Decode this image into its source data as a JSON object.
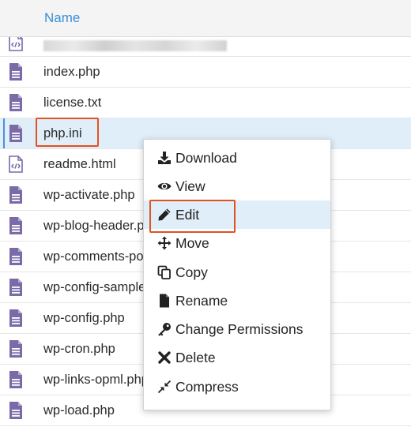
{
  "table": {
    "header": {
      "name_label": "Name"
    },
    "files": [
      {
        "name": "",
        "icon": "html-file-icon",
        "redacted": true
      },
      {
        "name": "index.php",
        "icon": "document-icon"
      },
      {
        "name": "license.txt",
        "icon": "document-icon"
      },
      {
        "name": "php.ini",
        "icon": "document-icon",
        "selected": true
      },
      {
        "name": "readme.html",
        "icon": "html-file-icon"
      },
      {
        "name": "wp-activate.php",
        "icon": "document-icon"
      },
      {
        "name": "wp-blog-header.php",
        "icon": "document-icon"
      },
      {
        "name": "wp-comments-post.php",
        "icon": "document-icon"
      },
      {
        "name": "wp-config-sample.php",
        "icon": "document-icon"
      },
      {
        "name": "wp-config.php",
        "icon": "document-icon"
      },
      {
        "name": "wp-cron.php",
        "icon": "document-icon"
      },
      {
        "name": "wp-links-opml.php",
        "icon": "document-icon"
      },
      {
        "name": "wp-load.php",
        "icon": "document-icon"
      }
    ]
  },
  "context_menu": {
    "items": [
      {
        "label": "Download",
        "icon": "download-icon"
      },
      {
        "label": "View",
        "icon": "eye-icon"
      },
      {
        "label": "Edit",
        "icon": "pencil-icon",
        "highlighted": true
      },
      {
        "label": "Move",
        "icon": "move-arrows-icon"
      },
      {
        "label": "Copy",
        "icon": "copy-icon"
      },
      {
        "label": "Rename",
        "icon": "file-icon"
      },
      {
        "label": "Change Permissions",
        "icon": "key-icon"
      },
      {
        "label": "Delete",
        "icon": "x-icon"
      },
      {
        "label": "Compress",
        "icon": "compress-icon"
      }
    ]
  },
  "colors": {
    "header_text": "#3a8fd8",
    "file_icon": "#7a6aa8",
    "selection": "#dfeef9",
    "annotation_box": "#e0531f"
  }
}
